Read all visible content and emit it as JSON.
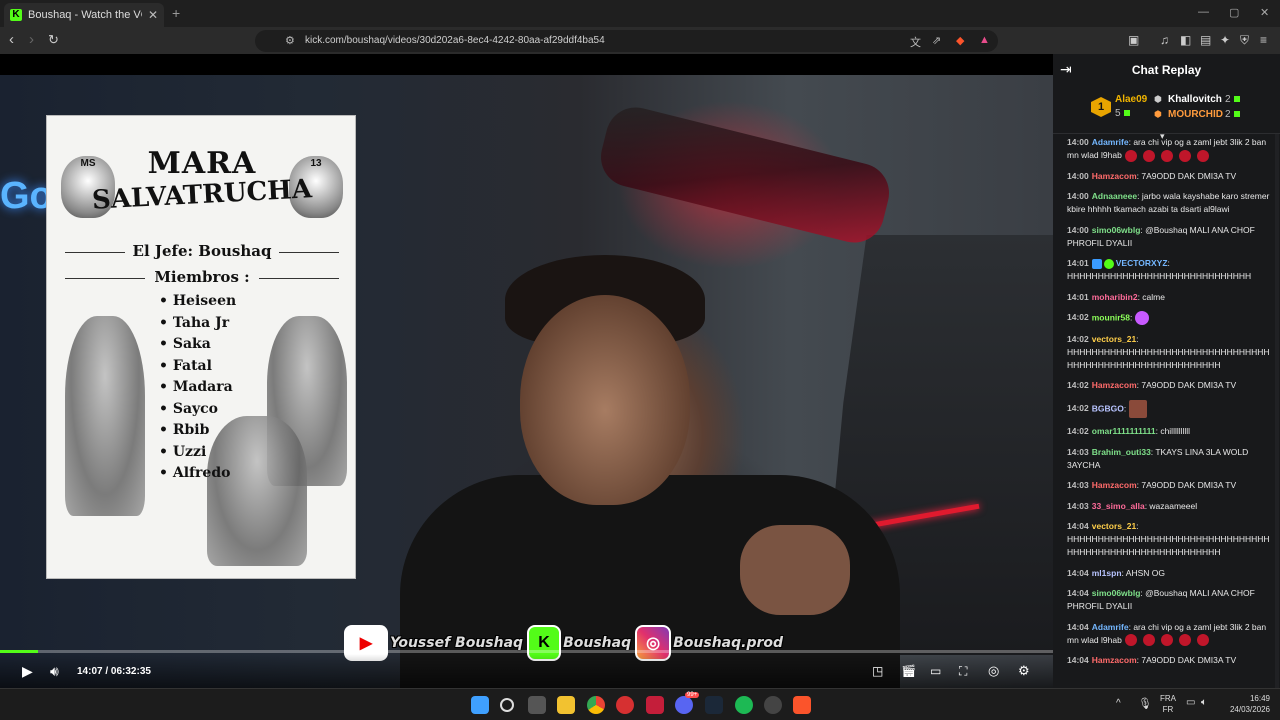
{
  "browser": {
    "tab_title": "Boushaq - Watch the VOD on Ki",
    "tab_favicon": "K",
    "close_glyph": "✕",
    "new_tab_glyph": "+",
    "url": "kick.com/boushaq/videos/30d202a6-8ec4-4242-80aa-af29ddf4ba54"
  },
  "poster": {
    "title_line1": "MARA",
    "title_line2": "SALVATRUCHA",
    "skull_left_text": "MS",
    "skull_right_text": "13",
    "jefe": "El Jefe: Boushaq",
    "miembros_label": "Miembros :",
    "members": [
      "Heiseen",
      "Taha Jr",
      "Saka",
      "Fatal",
      "Madara",
      "Sayco",
      "Rbib",
      "Uzzi",
      "Alfredo"
    ]
  },
  "social": {
    "youtube": "Youssef Boushaq",
    "kick": "Boushaq",
    "instagram": "Boushaq.prod"
  },
  "player": {
    "current_time": "14:07",
    "separator": "/",
    "duration": "06:32:35",
    "progress_fraction": 0.036
  },
  "chat": {
    "title": "Chat Replay",
    "leaders": [
      {
        "rank": "1",
        "name": "Alae09",
        "count": "5",
        "color": "#f0b400"
      },
      {
        "rank": "",
        "name": "Khallovitch",
        "count": "2",
        "color": "#ffffff"
      },
      {
        "rank": "",
        "name": "MOURCHID",
        "count": "2",
        "color": "#ff9b3d"
      }
    ],
    "messages": [
      {
        "time": "14:00",
        "user": "Adamrife",
        "color": "#74b7ff",
        "text": ": ara chi vip og a zaml jebt 3lik 2 ban mn wlad l9hab",
        "emotes": 5
      },
      {
        "time": "14:00",
        "user": "Hamzacom",
        "color": "#ff6b6b",
        "text": ": 7A9ODD DAK DMI3A TV",
        "emotes": 0
      },
      {
        "time": "14:00",
        "user": "Adnaaneee",
        "color": "#7fe08a",
        "text": ": jarbo wala kayshabe karo stremer kbire hhhhh tkamach azabi ta dsarti al9lawi",
        "emotes": 0
      },
      {
        "time": "14:00",
        "user": "simo06wblg",
        "color": "#7fe08a",
        "text": ": @Boushaq MALI ANA CHOF PHROFIL DYALII",
        "emotes": 0
      },
      {
        "time": "14:01",
        "user": "VECTORXYZ",
        "color": "#74b7ff",
        "text": ": HHHHHHHHHHHHHHHHHHHHHHHHHHHHHH",
        "emotes": 0,
        "badges": true
      },
      {
        "time": "14:01",
        "user": "moharibin2",
        "color": "#ff6b9a",
        "text": ": calme",
        "emotes": 0
      },
      {
        "time": "14:02",
        "user": "mounir58",
        "color": "#8cff5a",
        "text": ":",
        "emotes": 0,
        "sticker": true
      },
      {
        "time": "14:02",
        "user": "vectors_21",
        "color": "#ffcf4a",
        "text": ": HHHHHHHHHHHHHHHHHHHHHHHHHHHHHHHHHHHHHHHHHHHHHHHHHHHHHHHHHH",
        "emotes": 0
      },
      {
        "time": "14:02",
        "user": "Hamzacom",
        "color": "#ff6b6b",
        "text": ": 7A9ODD DAK DMI3A TV",
        "emotes": 0
      },
      {
        "time": "14:02",
        "user": "BGBGO",
        "color": "#b8c4ff",
        "text": ":",
        "emotes": 0,
        "image": true
      },
      {
        "time": "14:02",
        "user": "omar1111111111",
        "color": "#7fe08a",
        "text": ": chillllllllll",
        "emotes": 0
      },
      {
        "time": "14:03",
        "user": "Brahim_outi33",
        "color": "#7fe08a",
        "text": ": TKAYS LINA 3LA WOLD 3AYCHA",
        "emotes": 0
      },
      {
        "time": "14:03",
        "user": "Hamzacom",
        "color": "#ff6b6b",
        "text": ": 7A9ODD DAK DMI3A TV",
        "emotes": 0
      },
      {
        "time": "14:03",
        "user": "33_simo_alla",
        "color": "#ff6b9a",
        "text": ": wazaameeel",
        "emotes": 0
      },
      {
        "time": "14:04",
        "user": "vectors_21",
        "color": "#ffcf4a",
        "text": ": HHHHHHHHHHHHHHHHHHHHHHHHHHHHHHHHHHHHHHHHHHHHHHHHHHHHHHHHHH",
        "emotes": 0
      },
      {
        "time": "14:04",
        "user": "ml1spn",
        "color": "#b8c4ff",
        "text": ": AHSN OG",
        "emotes": 0
      },
      {
        "time": "14:04",
        "user": "simo06wblg",
        "color": "#7fe08a",
        "text": ": @Boushaq MALI ANA CHOF PHROFIL DYALII",
        "emotes": 0
      },
      {
        "time": "14:04",
        "user": "Adamrife",
        "color": "#74b7ff",
        "text": ": ara chi vip og a zaml jebt 3lik 2 ban mn wlad l9hab",
        "emotes": 5
      },
      {
        "time": "14:04",
        "user": "Hamzacom",
        "color": "#ff6b6b",
        "text": ": 7A9ODD DAK DMI3A TV",
        "emotes": 0
      }
    ]
  },
  "taskbar": {
    "lang_top": "FRA",
    "lang_bottom": "FR",
    "time": "16:49",
    "date": "24/03/2026",
    "notification_count": "99+"
  },
  "colors": {
    "kick_green": "#53fc18",
    "chat_bg": "#18191b",
    "browser_bg": "#2b2b2b"
  }
}
